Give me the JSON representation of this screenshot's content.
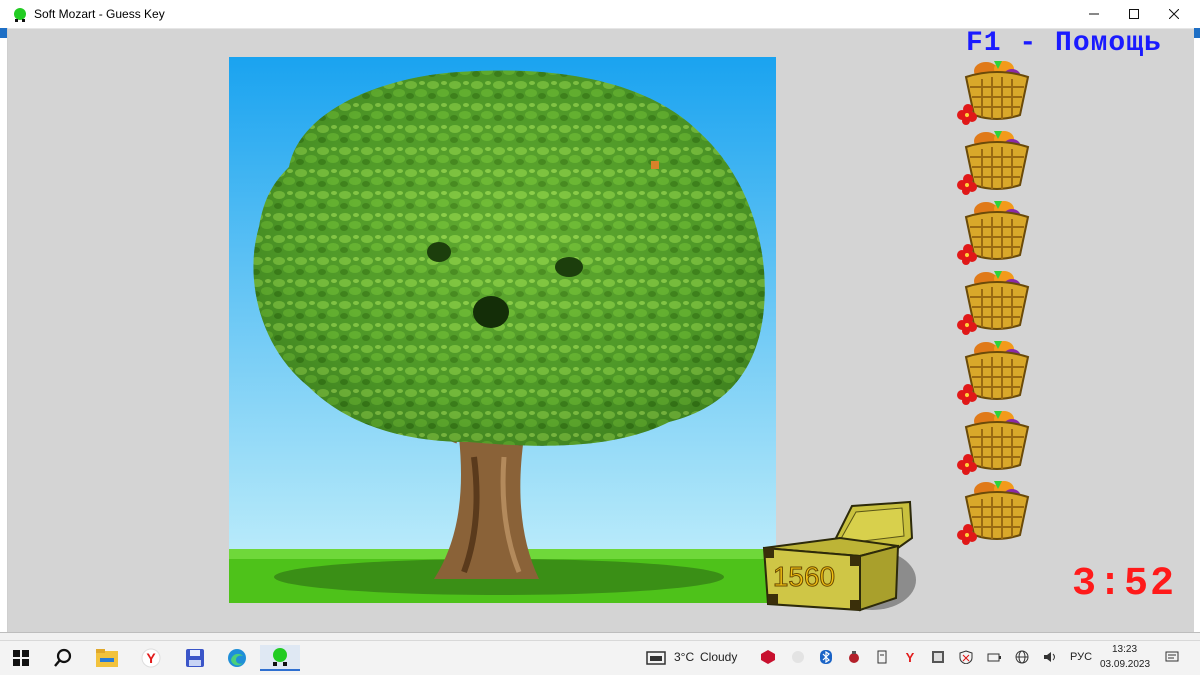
{
  "window": {
    "title": "Soft Mozart - Guess Key",
    "minimize_icon": "minimize-icon",
    "maximize_icon": "maximize-icon",
    "close_icon": "close-icon"
  },
  "game": {
    "help_text": "F1 - Помощь",
    "score": "1560",
    "timer": "3:52",
    "baskets_count": 7,
    "colors": {
      "help": "#1a1aff",
      "timer": "#ff1a1a",
      "score": "#f2c012",
      "sky_top": "#1aa3f0",
      "grass": "#4ec21a"
    }
  },
  "taskbar": {
    "weather_temp": "3°C",
    "weather_desc": "Cloudy",
    "language": "РУС",
    "time": "13:23",
    "date": "03.09.2023",
    "apps": [
      "windows-start-icon",
      "search-icon",
      "file-explorer-icon",
      "yandex-browser-icon",
      "save-floppy-icon",
      "edge-browser-icon",
      "soft-mozart-icon"
    ]
  }
}
